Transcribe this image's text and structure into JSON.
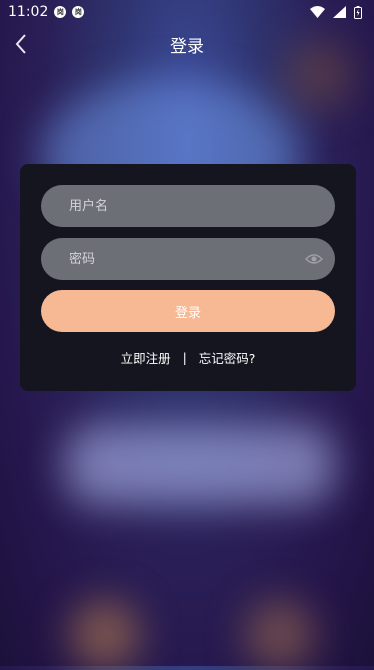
{
  "status_bar": {
    "time": "11:02",
    "badge_1": "岗",
    "badge_2": "岗"
  },
  "header": {
    "title": "登录"
  },
  "form": {
    "username_placeholder": "用户名",
    "username_value": "",
    "password_placeholder": "密码",
    "password_value": "",
    "login_label": "登录"
  },
  "links": {
    "register": "立即注册",
    "separator": "|",
    "forgot": "忘记密码?"
  },
  "colors": {
    "card_bg": "#14151f",
    "field_bg": "#6d6f77",
    "login_button": "#f7b894"
  }
}
